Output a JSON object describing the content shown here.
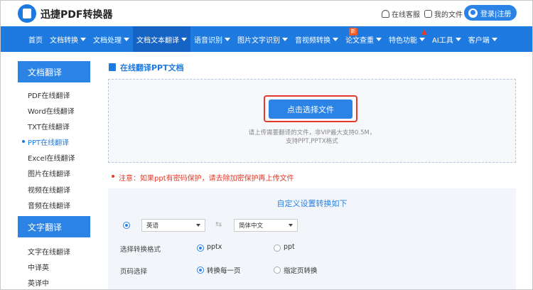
{
  "header": {
    "brand": "迅捷PDF转换器",
    "online_service": "在线客服",
    "my_files": "我的文件",
    "login": "登录|注册"
  },
  "nav": {
    "items": [
      {
        "label": "首页",
        "dropdown": false
      },
      {
        "label": "文档转换",
        "dropdown": true
      },
      {
        "label": "文档处理",
        "dropdown": true
      },
      {
        "label": "文档文本翻译",
        "dropdown": true,
        "active": true
      },
      {
        "label": "语音识别",
        "dropdown": true
      },
      {
        "label": "图片文字识别",
        "dropdown": true
      },
      {
        "label": "音视频转换",
        "dropdown": true
      },
      {
        "label": "论文查重",
        "dropdown": true
      },
      {
        "label": "特色功能",
        "dropdown": true
      },
      {
        "label": "AI工具",
        "dropdown": true
      },
      {
        "label": "客户端",
        "dropdown": true
      }
    ],
    "new_badge": "新"
  },
  "sidebar": {
    "doc_head": "文档翻译",
    "doc_items": [
      "PDF在线翻译",
      "Word在线翻译",
      "TXT在线翻译",
      "PPT在线翻译",
      "Excel在线翻译",
      "图片在线翻译",
      "视频在线翻译",
      "音频在线翻译"
    ],
    "selected_index": 3,
    "text_head": "文字翻译",
    "text_items": [
      "文字在线翻译",
      "中译英",
      "英译中"
    ]
  },
  "main": {
    "section_title": "在线翻译PPT文档",
    "choose_button": "点击选择文件",
    "tip_line1": "请上传需要翻译的文件，非VIP最大支持0.5M，",
    "tip_line2": "支持PPT,PPTX格式",
    "notice": "注意：如果ppt有密码保护，请去除加密保护再上传文件",
    "settings_title": "自定义设置转换如下",
    "source_lang": "英语",
    "target_lang": "简体中文",
    "format_label": "选择转换格式",
    "format_options": [
      "pptx",
      "ppt"
    ],
    "format_selected": "pptx",
    "pages_label": "页码选择",
    "pages_options": [
      "转换每一页",
      "指定页转换"
    ],
    "pages_selected": "转换每一页"
  },
  "colors": {
    "primary": "#1f7ae0",
    "accent_red": "#e23b2b"
  }
}
